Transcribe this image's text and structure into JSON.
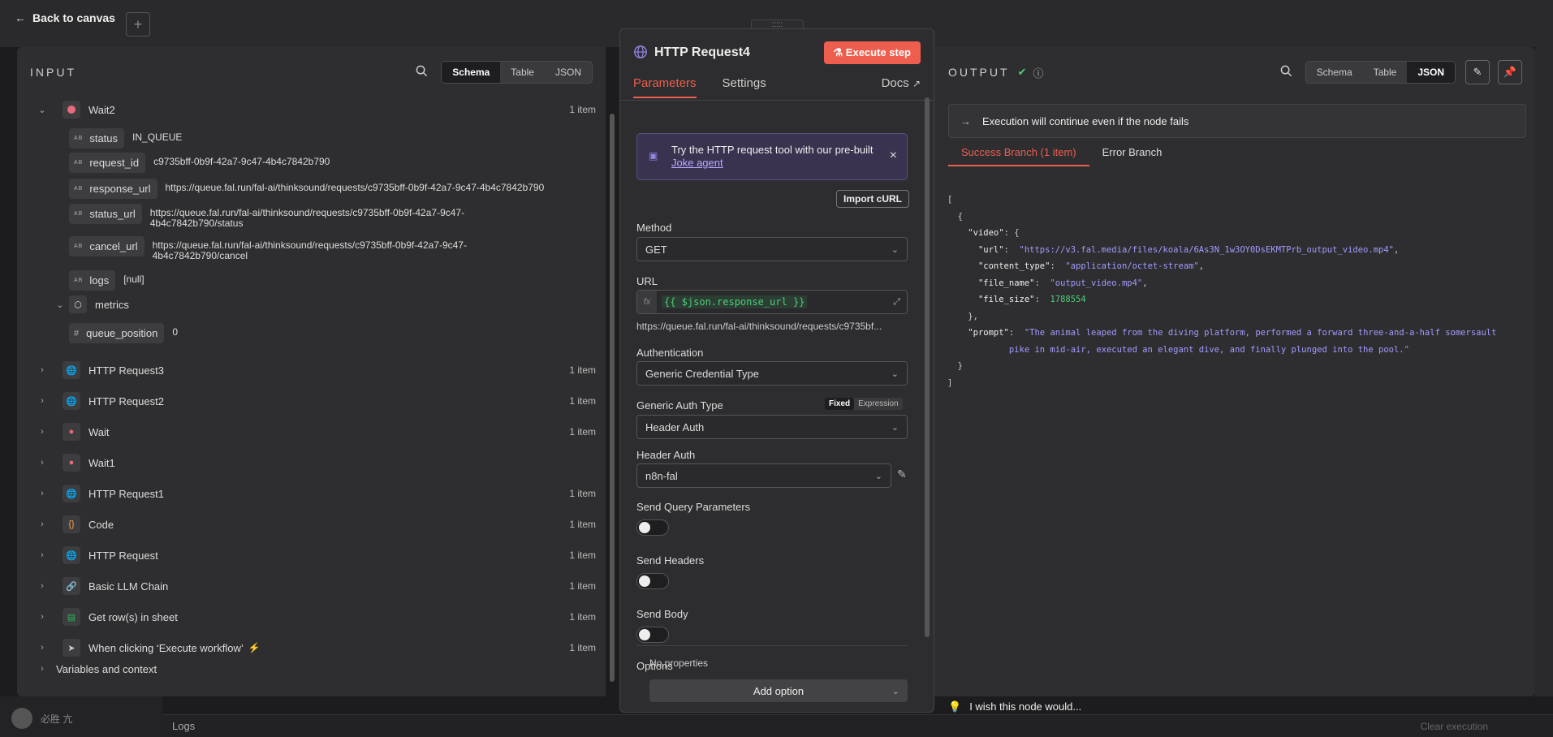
{
  "topbar": {
    "back_label": "Back to canvas",
    "plus": "+"
  },
  "input": {
    "title": "INPUT",
    "views": [
      "Schema",
      "Table",
      "JSON"
    ],
    "wait2": {
      "label": "Wait2",
      "count": "1 item"
    },
    "fields": [
      {
        "key": "status",
        "value": "IN_QUEUE"
      },
      {
        "key": "request_id",
        "value": "c9735bff-0b9f-42a7-9c47-4b4c7842b790"
      },
      {
        "key": "response_url",
        "value": "https://queue.fal.run/fal-ai/thinksound/requests/c9735bff-0b9f-42a7-9c47-4b4c7842b790"
      },
      {
        "key": "status_url",
        "value": "https://queue.fal.run/fal-ai/thinksound/requests/c9735bff-0b9f-42a7-9c47-",
        "value2": "4b4c7842b790/status"
      },
      {
        "key": "cancel_url",
        "value": "https://queue.fal.run/fal-ai/thinksound/requests/c9735bff-0b9f-42a7-9c47-",
        "value2": "4b4c7842b790/cancel"
      },
      {
        "key": "logs",
        "value": "[null]"
      }
    ],
    "metrics": {
      "label": "metrics",
      "key": "queue_position",
      "value": "0",
      "hash": "#"
    },
    "nodes": [
      {
        "label": "HTTP Request3",
        "count": "1 item"
      },
      {
        "label": "HTTP Request2",
        "count": "1 item"
      },
      {
        "label": "Wait",
        "count": "1 item"
      },
      {
        "label": "Wait1",
        "count": ""
      },
      {
        "label": "HTTP Request1",
        "count": "1 item"
      },
      {
        "label": "Code",
        "count": "1 item"
      },
      {
        "label": "HTTP Request",
        "count": "1 item"
      },
      {
        "label": "Basic LLM Chain",
        "count": "1 item"
      },
      {
        "label": "Get row(s) in sheet",
        "count": "1 item"
      },
      {
        "label": "When clicking ‘Execute workflow’",
        "count": "1 item"
      }
    ],
    "variables": "Variables and context"
  },
  "modal": {
    "handle": ":::::",
    "title": "HTTP Request4",
    "execute": "Execute step",
    "tabs": {
      "parameters": "Parameters",
      "settings": "Settings",
      "docs": "Docs"
    },
    "banner": {
      "text": "Try the HTTP request tool with our pre-built",
      "link": "Joke agent",
      "close": "×"
    },
    "import_curl": "Import cURL",
    "method": {
      "label": "Method",
      "value": "GET"
    },
    "url": {
      "label": "URL",
      "fx": "fx",
      "expr": "{{ $json.response_url }}",
      "preview": "https://queue.fal.run/fal-ai/thinksound/requests/c9735bf..."
    },
    "authentication": {
      "label": "Authentication",
      "value": "Generic Credential Type"
    },
    "generic_auth": {
      "label": "Generic Auth Type",
      "fixed": "Fixed",
      "expression": "Expression",
      "value": "Header Auth"
    },
    "header_auth": {
      "label": "Header Auth",
      "value": "n8n-fal"
    },
    "send_query": "Send Query Parameters",
    "send_headers": "Send Headers",
    "send_body": "Send Body",
    "options": {
      "label": "Options",
      "none": "No properties",
      "add": "Add option"
    }
  },
  "output": {
    "title": "OUTPUT",
    "views": [
      "Schema",
      "Table",
      "JSON"
    ],
    "notice": "Execution will continue even if the node fails",
    "tabs": {
      "success": "Success Branch (1 item)",
      "error": "Error Branch"
    },
    "json": {
      "url": "\"https://v3.fal.media/files/koala/6As3N_1w3OY0DsEKMTPrb_output_video.mp4\"",
      "content_type": "\"application/octet-stream\"",
      "file_name": "\"output_video.mp4\"",
      "file_size": "1788554",
      "prompt1": "\"The animal leaped from the diving platform, performed a forward three-and-a-half somersault",
      "prompt2": "pike in mid-air, executed an elegant dive, and finally plunged into the pool.\""
    },
    "wish": "I wish this node would..."
  },
  "footer": {
    "logs": "Logs",
    "clear": "Clear execution",
    "user": "必胜 亢"
  }
}
